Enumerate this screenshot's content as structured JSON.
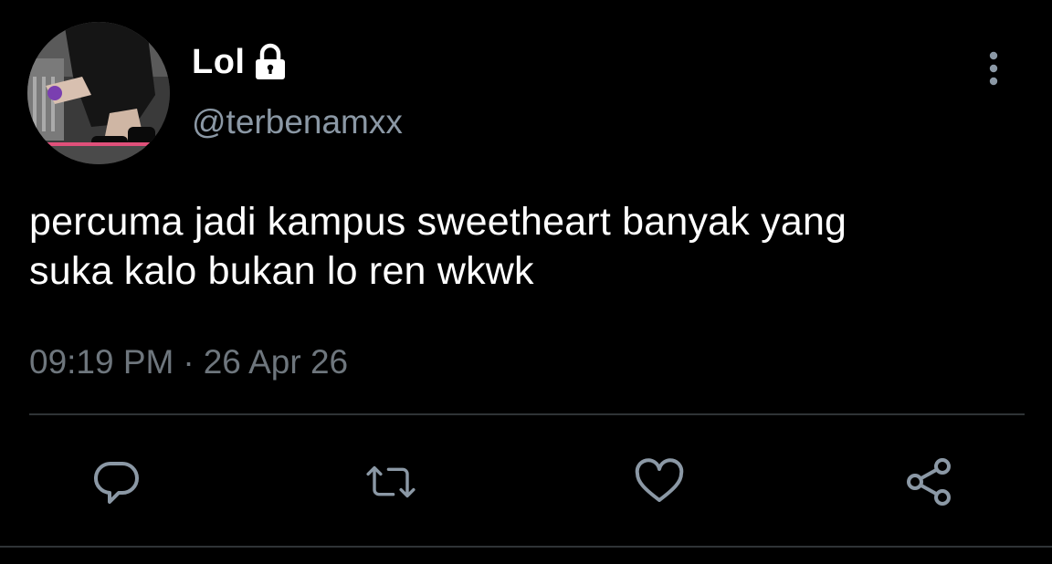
{
  "user": {
    "display_name": "Lol",
    "handle": "@terbenamxx",
    "avatar_icon": "profile-photo",
    "badge_icon": "lock-icon"
  },
  "tweet": {
    "text": "percuma jadi kampus sweetheart banyak yang\nsuka kalo bukan lo ren wkwk",
    "time": "09:19 PM",
    "separator": "·",
    "date": "26 Apr 26"
  },
  "actions": [
    {
      "icon": "reply-icon"
    },
    {
      "icon": "retweet-icon"
    },
    {
      "icon": "like-icon"
    },
    {
      "icon": "share-icon"
    }
  ],
  "menu_icon": "more-vertical-icon",
  "colors": {
    "background": "#000000",
    "primary_text": "#ffffff",
    "secondary_text": "#8b98a5",
    "timestamp_text": "#6e767d",
    "icon": "#8b98a5",
    "divider": "#2f3336"
  }
}
